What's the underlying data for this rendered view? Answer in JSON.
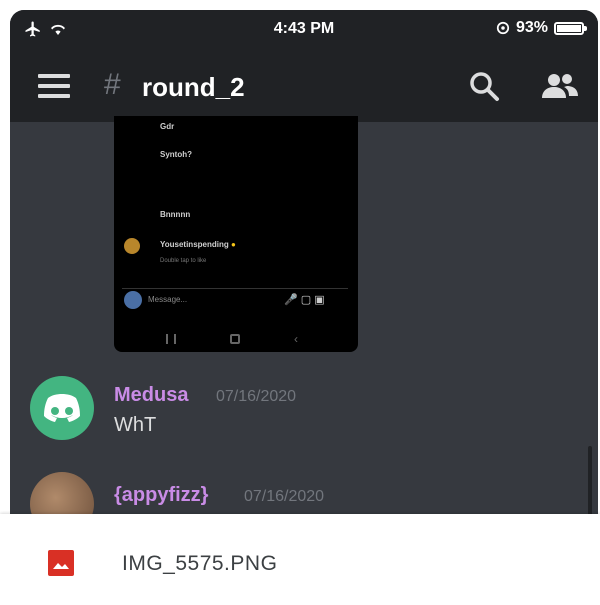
{
  "status_bar": {
    "time": "4:43 PM",
    "battery_text": "93%",
    "battery_level": 0.93,
    "icons": [
      "airplane-icon",
      "wifi-icon",
      "location-icon",
      "battery-icon"
    ]
  },
  "header": {
    "hash": "#",
    "channel_name": "round_2",
    "icons": [
      "hamburger-icon",
      "search-icon",
      "members-icon"
    ]
  },
  "embedded_image": {
    "rows": [
      "Gdr",
      "Syntoh?",
      "Bnnnnn",
      "Yousetinspending",
      "Double tap to like"
    ],
    "emoji": "😂😂",
    "input_placeholder": "Message..."
  },
  "messages": [
    {
      "username": "Medusa",
      "timestamp": "07/16/2020",
      "text": "WhT",
      "username_color": "#c98ce6",
      "avatar_color": "#43b581"
    },
    {
      "username": "{appyfizz}",
      "timestamp": "07/16/2020",
      "text": "",
      "username_color": "#c98ce6"
    }
  ],
  "file_sheet": {
    "filename": "IMG_5575.PNG",
    "icon": "image-file-icon",
    "icon_color": "#d93025"
  }
}
